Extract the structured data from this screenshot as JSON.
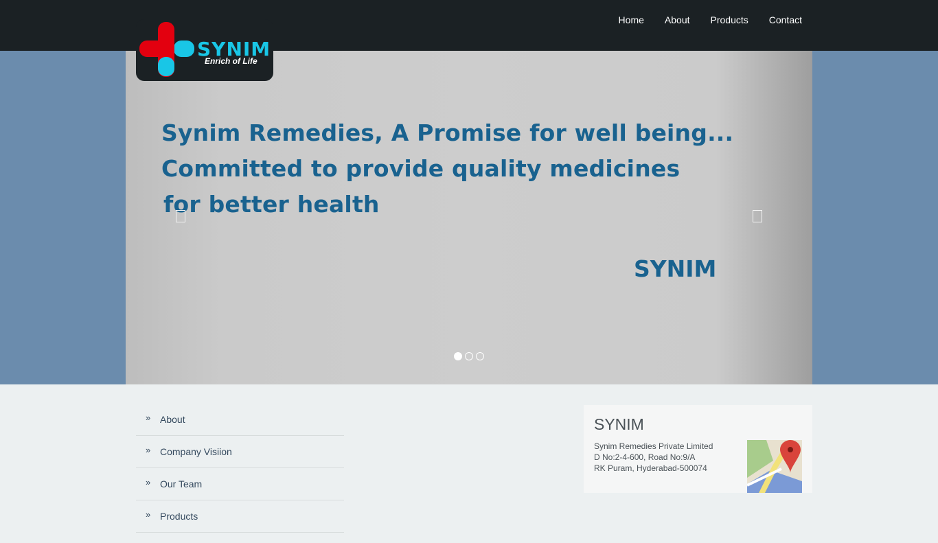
{
  "header": {
    "logo": {
      "name": "SYNIM",
      "tagline": "Enrich of Life"
    },
    "nav": [
      "Home",
      "About",
      "Products",
      "Contact"
    ]
  },
  "hero": {
    "lines": [
      "Synim Remedies, A Promise for well being...",
      "Committed to provide quality medicines",
      "for better health"
    ],
    "brand": "SYNIM",
    "slides": 3,
    "active_slide": 1
  },
  "links": [
    "About",
    "Company Visiion",
    "Our Team",
    "Products"
  ],
  "contact": {
    "title": "SYNIM",
    "address": [
      "Synim Remedies Private Limited",
      "D No:2-4-600, Road No:9/A",
      "RK Puram, Hyderabad-500074"
    ]
  },
  "colors": {
    "topbar": "#1b2124",
    "hero_band": "#6b8cad",
    "hero_text": "#19628f",
    "logo_red": "#e3000f",
    "logo_cyan": "#19c6e6",
    "page_bg": "#ecf0f1"
  }
}
